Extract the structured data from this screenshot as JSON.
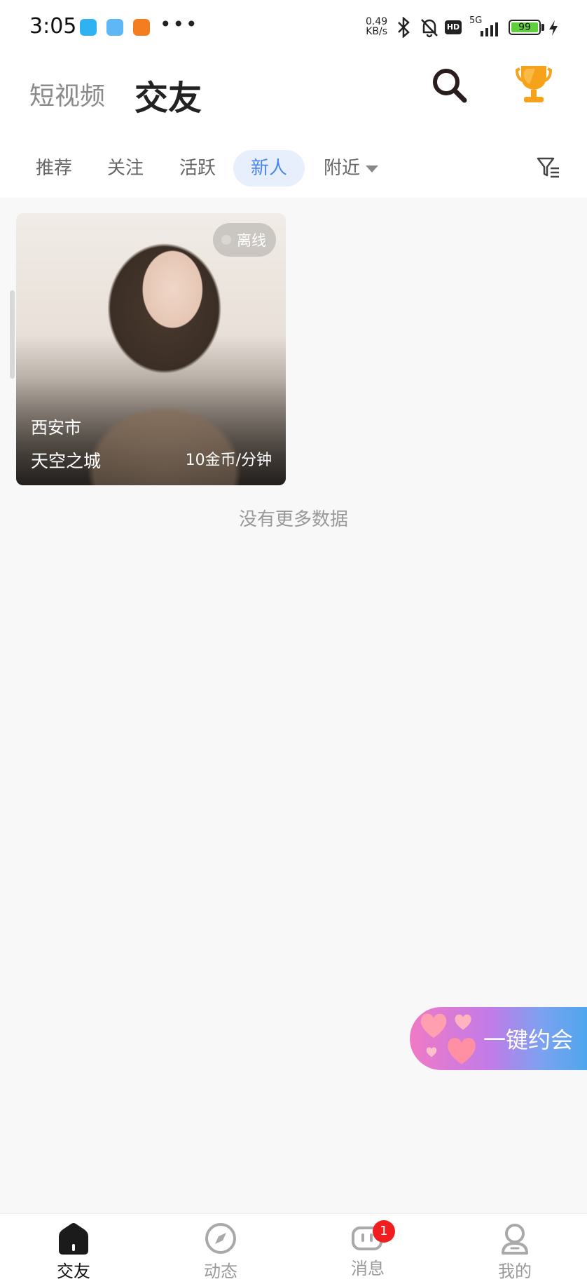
{
  "status_bar": {
    "time": "3:05",
    "net_speed_value": "0.49",
    "net_speed_unit": "KB/s",
    "network_label": "5G",
    "hd_label": "HD",
    "battery_level": "99"
  },
  "header": {
    "tab_short_video": "短视频",
    "tab_friends": "交友"
  },
  "filter_tabs": {
    "recommend": "推荐",
    "follow": "关注",
    "active": "活跃",
    "newcomer": "新人",
    "nearby": "附近",
    "selected": "新人"
  },
  "cards": [
    {
      "status": "离线",
      "city": "西安市",
      "name": "天空之城",
      "price": "10金币/分钟"
    }
  ],
  "list_footer": "没有更多数据",
  "quick_date_button": "一键约会",
  "bottom_nav": {
    "items": [
      {
        "label": "交友",
        "icon": "home-icon",
        "active": true
      },
      {
        "label": "动态",
        "icon": "compass-icon",
        "active": false
      },
      {
        "label": "消息",
        "icon": "message-icon",
        "active": false,
        "badge": "1"
      },
      {
        "label": "我的",
        "icon": "user-icon",
        "active": false
      }
    ]
  },
  "colors": {
    "accent_blue": "#4a86e8",
    "active_tab_bg": "#e7effd",
    "badge_red": "#f01e1e",
    "trophy_orange": "#f7a21b"
  }
}
